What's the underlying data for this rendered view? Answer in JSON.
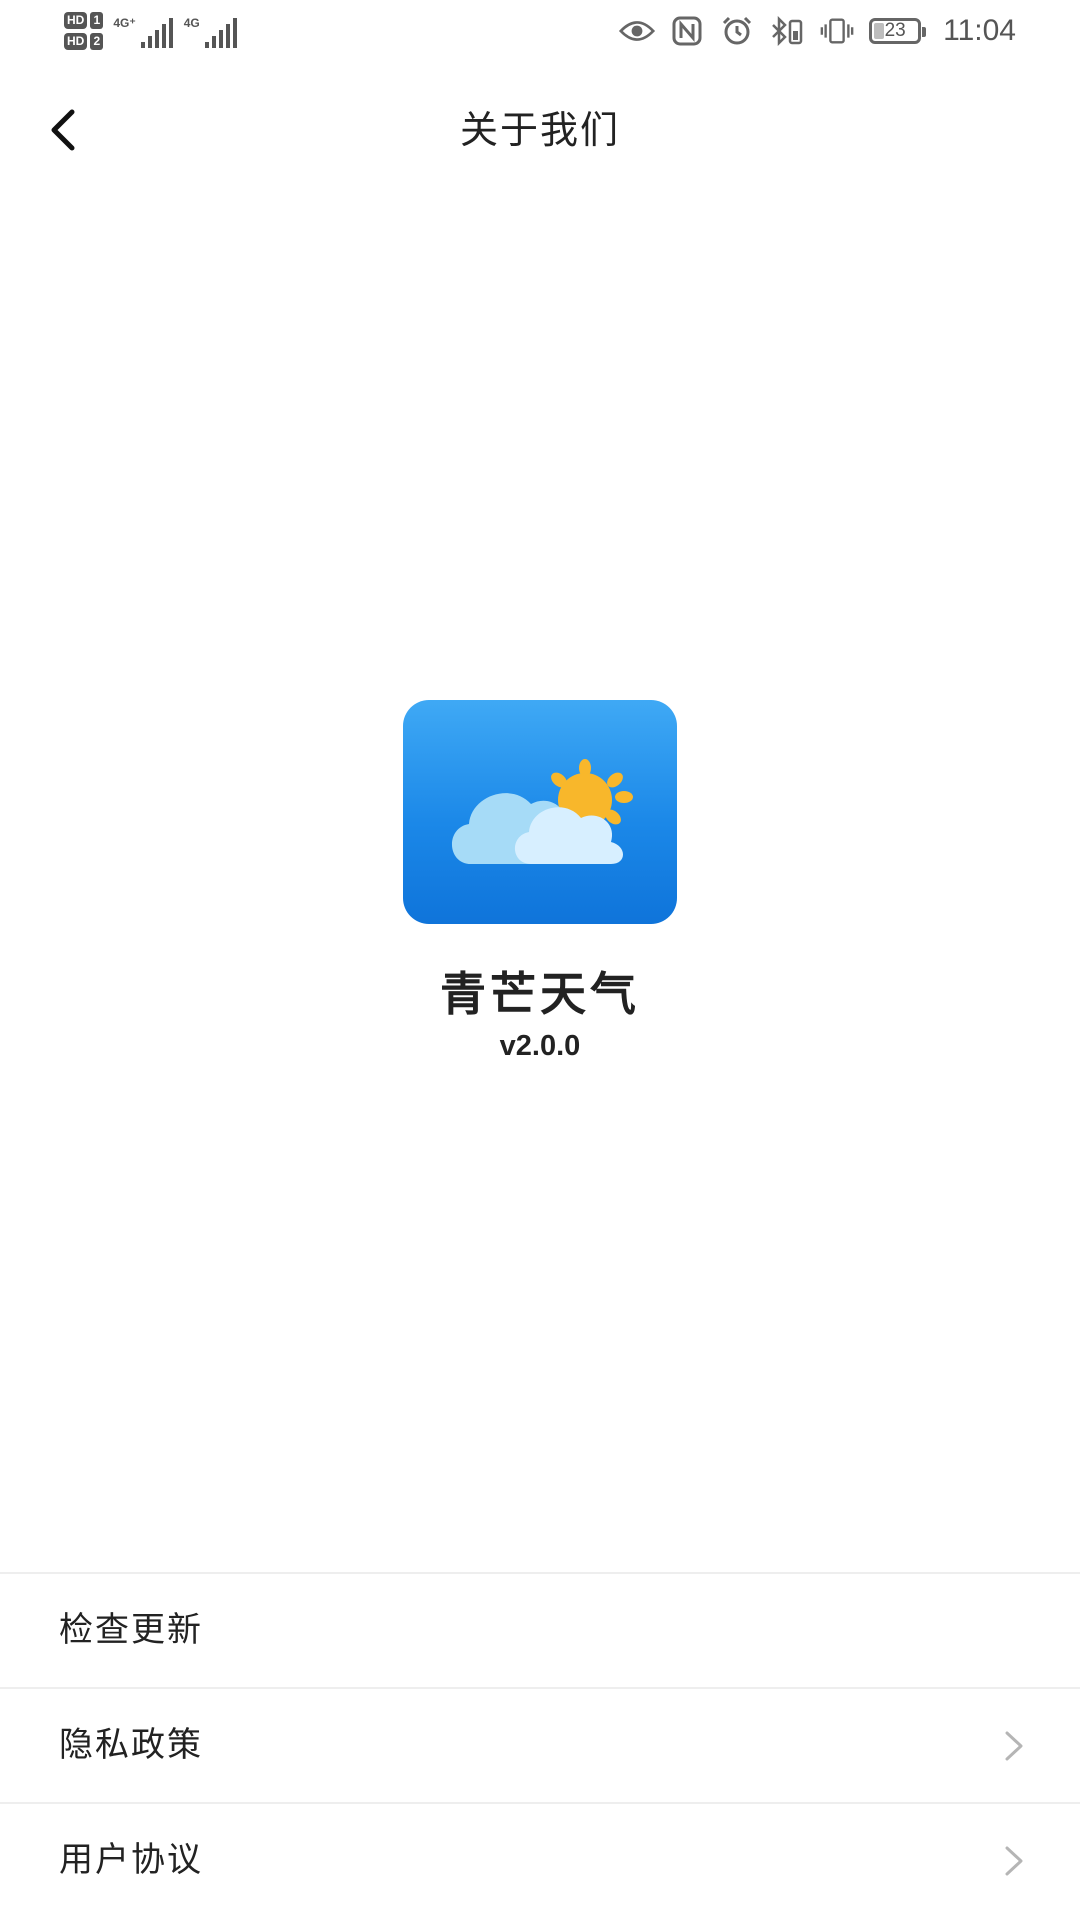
{
  "status_bar": {
    "sim1_badge": "HD",
    "sim1_num": "1",
    "sim2_badge": "HD",
    "sim2_num": "2",
    "net1_type": "4G⁺",
    "net2_type": "4G",
    "battery_level": "23",
    "battery_fraction": 0.23,
    "time": "11:04",
    "icons": [
      "eye-comfort-icon",
      "nfc-icon",
      "alarm-icon",
      "bluetooth-icon",
      "vibrate-icon"
    ]
  },
  "header": {
    "back_icon": "back-arrow-icon",
    "title": "关于我们"
  },
  "app": {
    "icon": "weather-cloud-sun-icon",
    "name": "青芒天气",
    "version": "v2.0.0"
  },
  "menu": {
    "items": [
      {
        "label": "检查更新",
        "has_chevron": false
      },
      {
        "label": "隐私政策",
        "has_chevron": true
      },
      {
        "label": "用户协议",
        "has_chevron": true
      }
    ]
  },
  "colors": {
    "icon_gradient_top": "#3fa9f5",
    "icon_gradient_bottom": "#0f74da",
    "sun": "#f8b72b",
    "cloud_back": "#a6dbf7",
    "cloud_front": "#d7efff",
    "divider": "#eeeeee",
    "chevron": "#b5b5b5",
    "text": "#222222"
  }
}
